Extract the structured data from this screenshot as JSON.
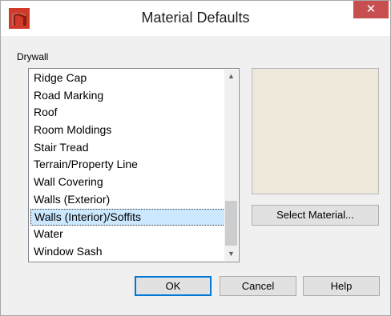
{
  "window": {
    "title": "Material Defaults",
    "close_glyph": "✕",
    "app_icon": "chief-architect-logo-icon",
    "accent_color": "#c74f4f"
  },
  "section": {
    "label": "Drywall"
  },
  "list": {
    "items": [
      "Ridge Cap",
      "Road Marking",
      "Roof",
      "Room Moldings",
      "Stair Tread",
      "Terrain/Property Line",
      "Wall Covering",
      "Walls (Exterior)",
      "Walls (Interior)/Soffits",
      "Water",
      "Window Sash"
    ],
    "selected": "Walls (Interior)/Soffits",
    "selected_color": "#cce8ff"
  },
  "preview": {
    "color": "#eee8da"
  },
  "buttons": {
    "select_material": "Select Material...",
    "ok": "OK",
    "cancel": "Cancel",
    "help": "Help"
  }
}
